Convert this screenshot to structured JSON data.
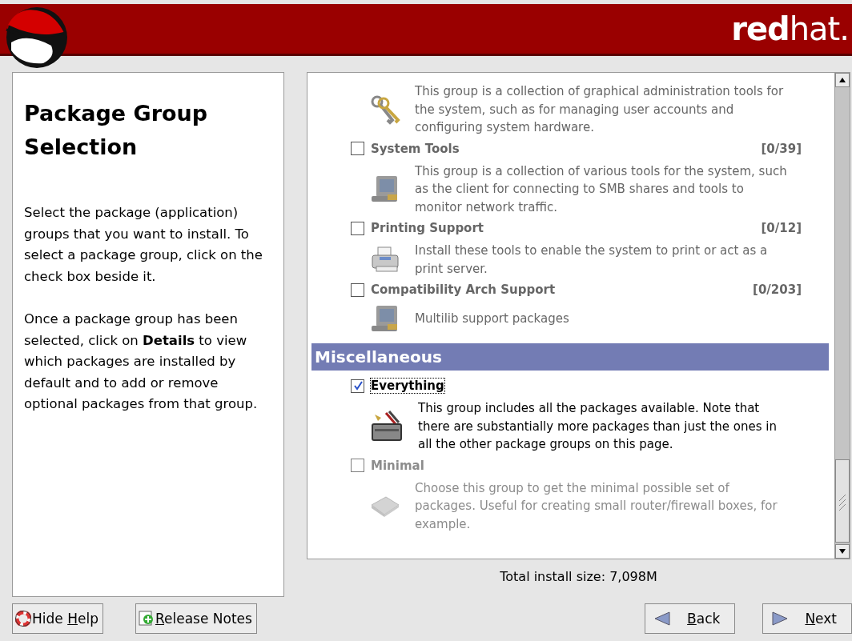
{
  "header": {
    "brand": "**red**hat."
  },
  "help": {
    "title": "Package Group Selection",
    "paragraphs": [
      "Select the package (application) groups that you want to install. To select a package group, click on the check box beside it.",
      "Once a package group has been selected, click on **Details** to view which packages are installed by default and to add or remove optional packages from that group."
    ]
  },
  "groups": [
    {
      "kind": "partial",
      "description": "This group is a collection of graphical administration tools for the system, such as for managing user accounts and configuring system hardware."
    },
    {
      "kind": "item",
      "title": "System Tools",
      "count": "[0/39]",
      "description": "This group is a collection of various tools for the system, such as the client for connecting to SMB shares and tools to monitor network traffic.",
      "checked": false,
      "disabled": false
    },
    {
      "kind": "item",
      "title": "Printing Support",
      "count": "[0/12]",
      "description": "Install these tools to enable the system to print or act as a print server.",
      "checked": false,
      "disabled": false
    },
    {
      "kind": "item",
      "title": "Compatibility Arch Support",
      "count": "[0/203]",
      "description": "Multilib support packages",
      "checked": false,
      "disabled": false
    },
    {
      "kind": "section",
      "title": "Miscellaneous"
    },
    {
      "kind": "item",
      "title": "Everything",
      "description": "This group includes all the packages available.  Note that there are substantially more packages than just the ones in all the other package groups on this page.",
      "checked": true,
      "disabled": false
    },
    {
      "kind": "item",
      "title": "Minimal",
      "description": "Choose this group to get the minimal possible set of packages.  Useful for creating small router/firewall boxes, for example.",
      "checked": false,
      "disabled": true
    }
  ],
  "total": "Total install size: 7,098M",
  "buttons": [
    {
      "kind": "help",
      "label_before": "Hide ",
      "mnemonic": "H",
      "label_after": "elp"
    },
    {
      "kind": "notes",
      "mnemonic": "R",
      "label_after": "elease Notes"
    },
    {
      "kind": "back",
      "mnemonic": "B",
      "label_after": "ack"
    },
    {
      "kind": "next",
      "mnemonic": "N",
      "label_after": "ext"
    }
  ]
}
